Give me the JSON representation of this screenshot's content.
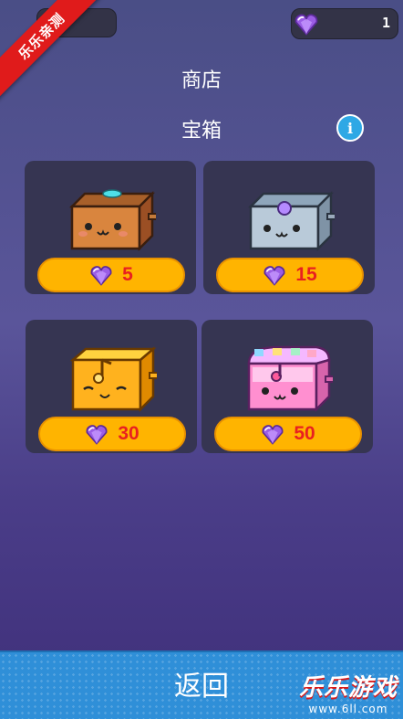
{
  "header": {
    "gem_count": "1"
  },
  "ribbon": {
    "text": "乐乐亲测"
  },
  "title": "商店",
  "subtitle": "宝箱",
  "info_button": {
    "label": "i"
  },
  "chests": [
    {
      "price": "5",
      "style": "wooden"
    },
    {
      "price": "15",
      "style": "silver"
    },
    {
      "price": "30",
      "style": "gold"
    },
    {
      "price": "50",
      "style": "rainbow"
    }
  ],
  "footer": {
    "back_label": "返回"
  },
  "watermark": {
    "title": "乐乐游戏",
    "url": "www.6ll.com"
  },
  "colors": {
    "accent_button": "#ffb400",
    "price_text": "#e82020",
    "footer": "#2f8fd8",
    "gem": "#9b5de5"
  }
}
